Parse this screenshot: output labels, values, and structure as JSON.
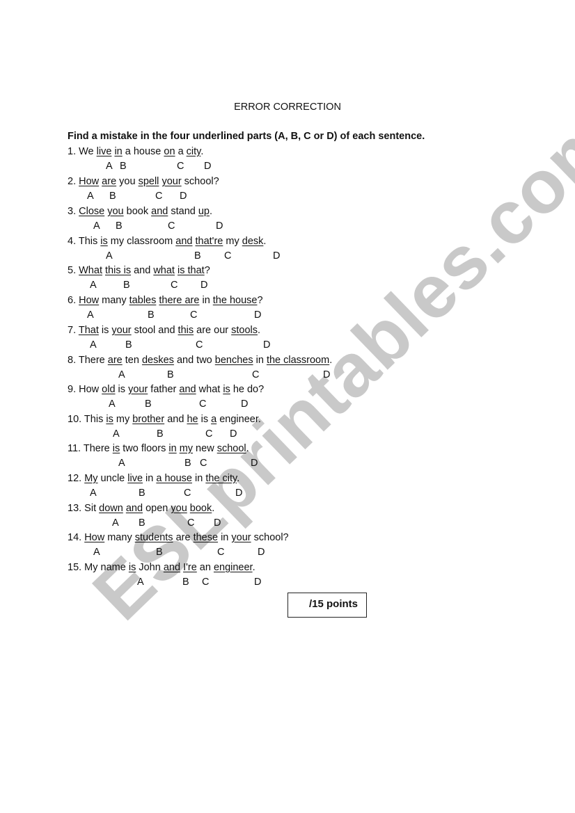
{
  "watermark": "ESLprintables.com",
  "title": "ERROR CORRECTION",
  "instructions": "Find a mistake in the four underlined parts (A, B, C or D) of each sentence.",
  "questions": [
    {
      "segments": [
        [
          "1. We ",
          0
        ],
        [
          "live",
          1
        ],
        [
          " ",
          0
        ],
        [
          "in",
          1
        ],
        [
          " a house ",
          0
        ],
        [
          "on",
          1
        ],
        [
          " a ",
          0
        ],
        [
          "city",
          1
        ],
        [
          ".",
          0
        ]
      ],
      "letters": [
        "A",
        "B",
        "C",
        "D"
      ]
    },
    {
      "segments": [
        [
          "2. ",
          0
        ],
        [
          "How",
          1
        ],
        [
          " ",
          0
        ],
        [
          "are",
          1
        ],
        [
          " you ",
          0
        ],
        [
          "spell",
          1
        ],
        [
          " ",
          0
        ],
        [
          "your",
          1
        ],
        [
          " school?",
          0
        ]
      ],
      "letters": [
        "A",
        "B",
        "C",
        "D"
      ]
    },
    {
      "segments": [
        [
          "3. ",
          0
        ],
        [
          "Close",
          1
        ],
        [
          " ",
          0
        ],
        [
          "you",
          1
        ],
        [
          " book ",
          0
        ],
        [
          "and",
          1
        ],
        [
          " stand ",
          0
        ],
        [
          "up",
          1
        ],
        [
          ".",
          0
        ]
      ],
      "letters": [
        "A",
        "B",
        "C",
        "D"
      ]
    },
    {
      "segments": [
        [
          "4. This ",
          0
        ],
        [
          "is",
          1
        ],
        [
          " my classroom ",
          0
        ],
        [
          "and",
          1
        ],
        [
          " ",
          0
        ],
        [
          "that're",
          1
        ],
        [
          " my ",
          0
        ],
        [
          "desk",
          1
        ],
        [
          ".",
          0
        ]
      ],
      "letters": [
        "A",
        "B",
        "C",
        "D"
      ]
    },
    {
      "segments": [
        [
          "5. ",
          0
        ],
        [
          "What",
          1
        ],
        [
          " ",
          0
        ],
        [
          "this is",
          1
        ],
        [
          " and ",
          0
        ],
        [
          "what",
          1
        ],
        [
          " ",
          0
        ],
        [
          "is that",
          1
        ],
        [
          "?",
          0
        ]
      ],
      "letters": [
        "A",
        "B",
        "C",
        "D"
      ]
    },
    {
      "segments": [
        [
          "6. ",
          0
        ],
        [
          "How",
          1
        ],
        [
          " many ",
          0
        ],
        [
          "tables",
          1
        ],
        [
          " ",
          0
        ],
        [
          "there are",
          1
        ],
        [
          " in ",
          0
        ],
        [
          "the house",
          1
        ],
        [
          "?",
          0
        ]
      ],
      "letters": [
        "A",
        "B",
        "C",
        "D"
      ]
    },
    {
      "segments": [
        [
          "7. ",
          0
        ],
        [
          "That",
          1
        ],
        [
          " is ",
          0
        ],
        [
          "your",
          1
        ],
        [
          " stool and ",
          0
        ],
        [
          "this",
          1
        ],
        [
          " are our ",
          0
        ],
        [
          "stools",
          1
        ],
        [
          ".",
          0
        ]
      ],
      "letters": [
        "A",
        "B",
        "C",
        "D"
      ]
    },
    {
      "segments": [
        [
          "8. There ",
          0
        ],
        [
          "are",
          1
        ],
        [
          " ten ",
          0
        ],
        [
          "deskes",
          1
        ],
        [
          " and two ",
          0
        ],
        [
          "benches",
          1
        ],
        [
          " in ",
          0
        ],
        [
          "the classroom",
          1
        ],
        [
          ".",
          0
        ]
      ],
      "letters": [
        "A",
        "B",
        "C",
        "D"
      ]
    },
    {
      "segments": [
        [
          "9. How ",
          0
        ],
        [
          "old",
          1
        ],
        [
          " is ",
          0
        ],
        [
          "your",
          1
        ],
        [
          " father ",
          0
        ],
        [
          "and",
          1
        ],
        [
          " what ",
          0
        ],
        [
          "is",
          1
        ],
        [
          " he do?",
          0
        ]
      ],
      "letters": [
        "A",
        "B",
        "C",
        "D"
      ]
    },
    {
      "segments": [
        [
          "10. This ",
          0
        ],
        [
          "is",
          1
        ],
        [
          " my ",
          0
        ],
        [
          "brother",
          1
        ],
        [
          " and ",
          0
        ],
        [
          "he",
          1
        ],
        [
          " is ",
          0
        ],
        [
          "a",
          1
        ],
        [
          " engineer.",
          0
        ]
      ],
      "letters": [
        "A",
        "B",
        "C",
        "D"
      ]
    },
    {
      "segments": [
        [
          "11. There ",
          0
        ],
        [
          "is",
          1
        ],
        [
          " two floors ",
          0
        ],
        [
          "in",
          1
        ],
        [
          " ",
          0
        ],
        [
          "my",
          1
        ],
        [
          " new ",
          0
        ],
        [
          "school",
          1
        ],
        [
          ".",
          0
        ]
      ],
      "letters": [
        "A",
        "B",
        "C",
        "D"
      ]
    },
    {
      "segments": [
        [
          "12. ",
          0
        ],
        [
          "My",
          1
        ],
        [
          " uncle ",
          0
        ],
        [
          "live",
          1
        ],
        [
          " in ",
          0
        ],
        [
          "a house",
          1
        ],
        [
          " in ",
          0
        ],
        [
          "the city",
          1
        ],
        [
          ".",
          0
        ]
      ],
      "letters": [
        "A",
        "B",
        "C",
        "D"
      ]
    },
    {
      "segments": [
        [
          "13. Sit ",
          0
        ],
        [
          "down",
          1
        ],
        [
          " ",
          0
        ],
        [
          "and",
          1
        ],
        [
          " open ",
          0
        ],
        [
          "you",
          1
        ],
        [
          " ",
          0
        ],
        [
          "book",
          1
        ],
        [
          ".",
          0
        ]
      ],
      "letters": [
        "A",
        "B",
        "C",
        "D"
      ]
    },
    {
      "segments": [
        [
          "14. ",
          0
        ],
        [
          "How",
          1
        ],
        [
          " many ",
          0
        ],
        [
          "students",
          1
        ],
        [
          " are ",
          0
        ],
        [
          "these",
          1
        ],
        [
          " in ",
          0
        ],
        [
          "your",
          1
        ],
        [
          " school?",
          0
        ]
      ],
      "letters": [
        "A",
        "B",
        "C",
        "D"
      ]
    },
    {
      "segments": [
        [
          "15. My name ",
          0
        ],
        [
          "is",
          1
        ],
        [
          " John ",
          0
        ],
        [
          "and",
          1
        ],
        [
          " ",
          0
        ],
        [
          "I're",
          1
        ],
        [
          " an ",
          0
        ],
        [
          "engineer",
          1
        ],
        [
          ".",
          0
        ]
      ],
      "letters": [
        "A",
        "B",
        "C",
        "D"
      ]
    }
  ],
  "score": "/15 points"
}
